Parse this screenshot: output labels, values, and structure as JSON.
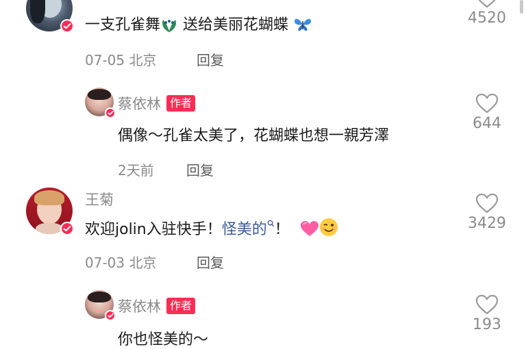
{
  "comments": [
    {
      "text_parts": [
        "一支孔雀舞",
        " 送给美丽花蝴蝶 "
      ],
      "emoji": [
        "peacock-emoji",
        "butterfly-emoji"
      ],
      "likes": "4520",
      "date": "07-05",
      "location": "北京",
      "reply_label": "回复"
    },
    {
      "author": "蔡依林",
      "badge": "作者",
      "text": "偶像～孔雀太美了，花蝴蝶也想一親芳澤",
      "likes": "644",
      "date": "2天前",
      "reply_label": "回复"
    },
    {
      "author": "王菊",
      "text_before": "欢迎jolin入驻快手！",
      "link_text": "怪美的",
      "text_after": "！",
      "emoji": [
        "heart-emoji",
        "wink-emoji"
      ],
      "likes": "3429",
      "date": "07-03",
      "location": "北京",
      "reply_label": "回复"
    },
    {
      "author": "蔡依林",
      "badge": "作者",
      "text": "你也怪美的～",
      "likes": "193"
    }
  ],
  "colors": {
    "accent": "#fe2c55",
    "link": "#3a5a9a",
    "muted": "#8a8a8a"
  }
}
